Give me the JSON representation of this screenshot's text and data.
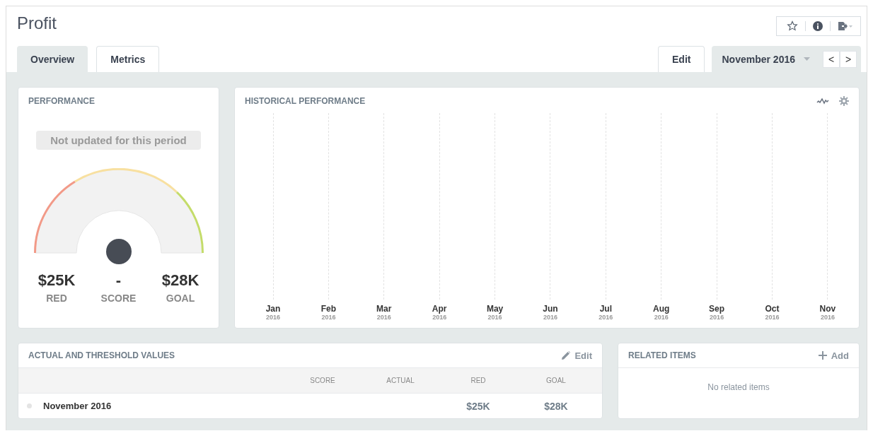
{
  "title": "Profit",
  "tabs": [
    {
      "label": "Overview",
      "selected": true
    },
    {
      "label": "Metrics",
      "selected": false
    }
  ],
  "edit_tab": "Edit",
  "period": {
    "label": "November 2016",
    "prev": "<",
    "next": ">"
  },
  "performance": {
    "title": "PERFORMANCE",
    "notice": "Not updated for this period",
    "stats": [
      {
        "value": "$25K",
        "label": "RED"
      },
      {
        "value": "-",
        "label": "SCORE"
      },
      {
        "value": "$28K",
        "label": "GOAL"
      }
    ]
  },
  "historical": {
    "title": "HISTORICAL PERFORMANCE",
    "months": [
      {
        "month": "Jan",
        "year": "2016"
      },
      {
        "month": "Feb",
        "year": "2016"
      },
      {
        "month": "Mar",
        "year": "2016"
      },
      {
        "month": "Apr",
        "year": "2016"
      },
      {
        "month": "May",
        "year": "2016"
      },
      {
        "month": "Jun",
        "year": "2016"
      },
      {
        "month": "Jul",
        "year": "2016"
      },
      {
        "month": "Aug",
        "year": "2016"
      },
      {
        "month": "Sep",
        "year": "2016"
      },
      {
        "month": "Oct",
        "year": "2016"
      },
      {
        "month": "Nov",
        "year": "2016"
      }
    ]
  },
  "values_table": {
    "title": "ACTUAL AND THRESHOLD VALUES",
    "action": "Edit",
    "columns": [
      "SCORE",
      "ACTUAL",
      "RED",
      "GOAL"
    ],
    "rows": [
      {
        "period": "November 2016",
        "red": "$25K",
        "goal": "$28K"
      }
    ]
  },
  "related": {
    "title": "RELATED ITEMS",
    "action": "Add",
    "empty": "No related items"
  }
}
